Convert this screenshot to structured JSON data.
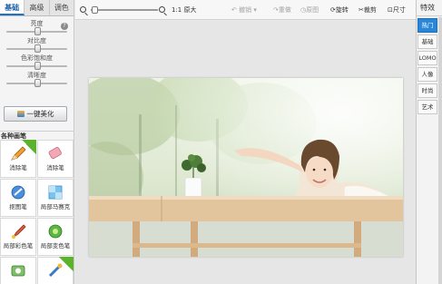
{
  "left_panel": {
    "tabs": [
      "基础",
      "高级",
      "调色"
    ],
    "active_tab": "基础",
    "help_icon_glyph": "?",
    "sliders": [
      {
        "label": "亮度",
        "value": 0.5
      },
      {
        "label": "对比度",
        "value": 0.5
      },
      {
        "label": "色彩饱和度",
        "value": 0.5
      },
      {
        "label": "清晰度",
        "value": 0.5
      }
    ],
    "beautify_button": "一键美化",
    "brush_section_title": "各种画笔",
    "brushes": [
      {
        "label": "消除笔",
        "icon": "pencil-icon",
        "badge": true
      },
      {
        "label": "消除笔",
        "icon": "eraser-icon",
        "badge": false
      },
      {
        "label": "抠图笔",
        "icon": "cutout-brush-icon",
        "badge": false
      },
      {
        "label": "局部马赛克",
        "icon": "mosaic-icon",
        "badge": false
      },
      {
        "label": "局部彩色笔",
        "icon": "color-brush-icon",
        "badge": false
      },
      {
        "label": "局部变色笔",
        "icon": "color-change-icon",
        "badge": false
      },
      {
        "label": "",
        "icon": "camera-brush-icon",
        "badge": false
      },
      {
        "label": "",
        "icon": "magic-brush-icon",
        "badge": true
      }
    ]
  },
  "toolbar": {
    "zoom_level": 0.05,
    "actual_size": "1:1 原大",
    "zoom_in": "放大",
    "undo": "撤销",
    "redo": "重做",
    "reset": "原图",
    "rotate": "旋转",
    "crop": "裁剪",
    "resize": "尺寸"
  },
  "right_panel": {
    "title": "特效",
    "tabs": [
      "热门",
      "基础",
      "LOMO",
      "人像",
      "时尚",
      "艺术"
    ],
    "active_tab": "热门"
  },
  "colors": {
    "accent": "#2a86d8",
    "badge_green": "#5bb32c"
  }
}
